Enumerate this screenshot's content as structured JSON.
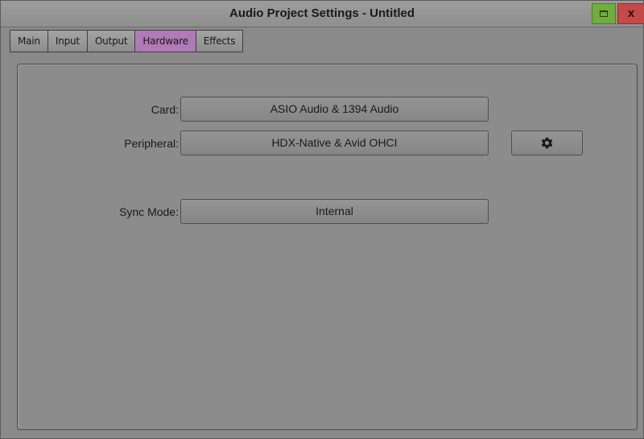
{
  "window": {
    "title": "Audio Project Settings - Untitled",
    "close_glyph": "x",
    "maximize_icon": "maximize-icon"
  },
  "tabs": [
    {
      "label": "Main"
    },
    {
      "label": "Input"
    },
    {
      "label": "Output"
    },
    {
      "label": "Hardware",
      "active": true
    },
    {
      "label": "Effects"
    }
  ],
  "hardware": {
    "card_label": "Card:",
    "card_value": "ASIO Audio & 1394 Audio",
    "peripheral_label": "Peripheral:",
    "peripheral_value": "HDX-Native & Avid OHCI",
    "peripheral_settings_icon": "gear-icon",
    "sync_mode_label": "Sync Mode:",
    "sync_mode_value": "Internal"
  },
  "colors": {
    "active_tab": "#b07ab6",
    "maximize_button": "#6fae3a",
    "close_button": "#c44a4a",
    "background": "#8a8a8a"
  }
}
